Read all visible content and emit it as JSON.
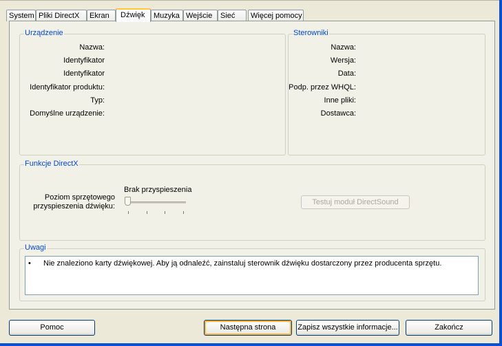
{
  "tabs": [
    {
      "label": "System"
    },
    {
      "label": "Pliki DirectX"
    },
    {
      "label": "Ekran"
    },
    {
      "label": "Dźwięk"
    },
    {
      "label": "Muzyka"
    },
    {
      "label": "Wejście"
    },
    {
      "label": "Sieć"
    },
    {
      "label": "Więcej pomocy"
    }
  ],
  "device": {
    "title": "Urządzenie",
    "labels": [
      "Nazwa:",
      "Identyfikator",
      "Identyfikator",
      "Identyfikator produktu:",
      "Typ:",
      "Domyślne urządzenie:"
    ]
  },
  "driver": {
    "title": "Sterowniki",
    "labels": [
      "Nazwa:",
      "Wersja:",
      "Data:",
      "Podp. przez WHQL:",
      "Inne pliki:",
      "Dostawca:"
    ]
  },
  "directx": {
    "title": "Funkcje DirectX",
    "accel_label_line1": "Poziom sprzętowego",
    "accel_label_line2": "przyspieszenia dźwięku:",
    "accel_value": "Brak przyspieszenia",
    "accel_level": 0,
    "test_button": "Testuj moduł DirectSound"
  },
  "notes": {
    "title": "Uwagi",
    "bullet": "•",
    "items": [
      "Nie znaleziono karty dźwiękowej. Aby ją odnaleźć, zainstaluj sterownik dźwięku dostarczony przez producenta sprzętu."
    ]
  },
  "buttons": {
    "help": "Pomoc",
    "next": "Następna strona",
    "save": "Zapisz wszystkie informacje...",
    "exit": "Zakończ"
  }
}
